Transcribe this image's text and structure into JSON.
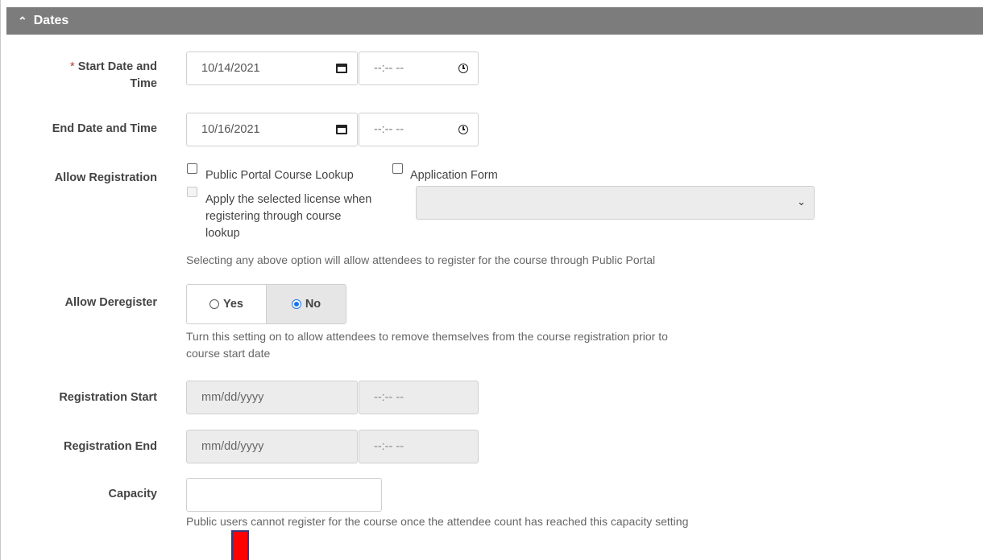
{
  "section": {
    "title": "Dates",
    "collapse_icon": "chevron-up-icon"
  },
  "start": {
    "required_mark": "*",
    "label_line1": "Start Date and",
    "label_line2": "Time",
    "date_value": "10/14/2021",
    "time_value": "--:-- --"
  },
  "end": {
    "label": "End Date and Time",
    "date_value": "10/16/2021",
    "time_value": "--:-- --"
  },
  "registration": {
    "label": "Allow Registration",
    "option_public_portal": "Public Portal Course Lookup",
    "option_application_form": "Application Form",
    "license_line1": "Apply the selected license when",
    "license_line2": "registering through course",
    "license_line3": "lookup",
    "license_select_value": "",
    "help": "Selecting any above option will allow attendees to register for the course through Public Portal"
  },
  "deregister": {
    "label": "Allow Deregister",
    "yes_label": "Yes",
    "no_label": "No",
    "selected": "No",
    "help_line1": "Turn this setting on to allow attendees to remove themselves from the course registration prior to",
    "help_line2": "course start date"
  },
  "registration_start": {
    "label": "Registration Start",
    "date_placeholder": "mm/dd/yyyy",
    "time_placeholder": "--:-- --"
  },
  "registration_end": {
    "label": "Registration End",
    "date_placeholder": "mm/dd/yyyy",
    "time_placeholder": "--:-- --"
  },
  "capacity": {
    "label": "Capacity",
    "value": "",
    "help": "Public users cannot register for the course once the attendee count has reached this capacity setting"
  },
  "colors": {
    "header_bg": "#7c7c7c",
    "required": "#c0392b",
    "radio_selected": "#1a73e8",
    "marker": "#ff0000"
  }
}
